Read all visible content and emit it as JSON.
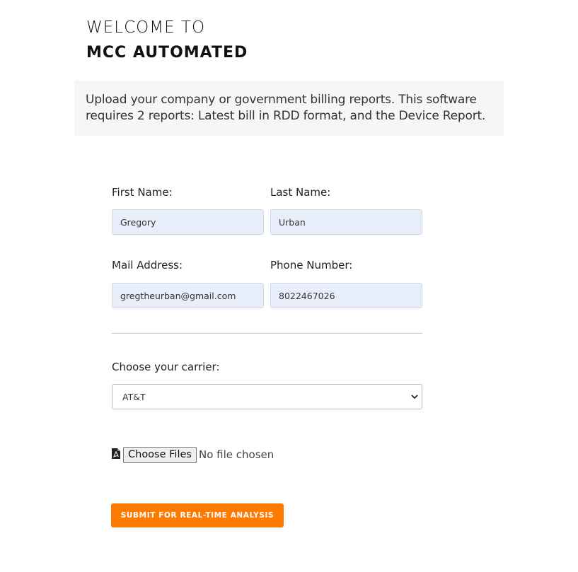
{
  "header": {
    "line1": "WELCOME TO",
    "line2": "MCC AUTOMATED"
  },
  "intro": {
    "text": "Upload your company or government billing reports. This software requires 2 reports: Latest bill in RDD format, and the Device Report."
  },
  "form": {
    "first_name": {
      "label": "First Name:",
      "value": "Gregory"
    },
    "last_name": {
      "label": "Last Name:",
      "value": "Urban"
    },
    "mail_address": {
      "label": "Mail Address:",
      "value": "gregtheurban@gmail.com"
    },
    "phone_number": {
      "label": "Phone Number:",
      "value": "8022467026"
    },
    "carrier": {
      "label": "Choose your carrier:",
      "selected": "AT&T",
      "icon": "chevron-down-icon"
    },
    "file_upload": {
      "icon": "pdf-file-icon",
      "button_label": "Choose Files",
      "status": "No file chosen"
    },
    "submit": {
      "label": "SUBMIT FOR REAL-TIME ANALYSIS"
    }
  },
  "colors": {
    "accent": "#ff7a00",
    "input_background": "#e8effb",
    "intro_background": "#f6f6f6"
  }
}
